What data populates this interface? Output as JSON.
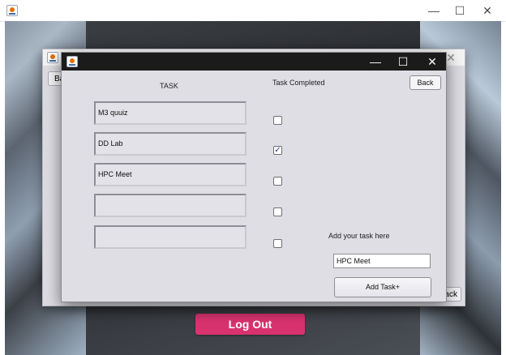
{
  "outer_window": {
    "controls": {
      "minimize": "—",
      "maximize": "☐",
      "close": "✕"
    }
  },
  "mid_window": {
    "back_left": "Back",
    "back_right": "Back",
    "close": "✕"
  },
  "front_window": {
    "controls": {
      "minimize": "—",
      "maximize": "☐",
      "close": "✕"
    },
    "task_header": "TASK",
    "completed_header": "Task Completed",
    "back_label": "Back",
    "tasks": [
      {
        "text": "M3 quuiz",
        "completed": false
      },
      {
        "text": "DD Lab",
        "completed": true
      },
      {
        "text": "HPC Meet",
        "completed": false
      },
      {
        "text": "",
        "completed": false
      },
      {
        "text": "",
        "completed": false
      }
    ],
    "add_prompt": "Add your task here",
    "add_input_value": "HPC Meet",
    "add_button_label": "Add Task+"
  },
  "logout_label": "Log Out",
  "colors": {
    "logout": "#d9336f",
    "titlebar_dark": "#1b1b1b",
    "panel": "#dedee4"
  }
}
